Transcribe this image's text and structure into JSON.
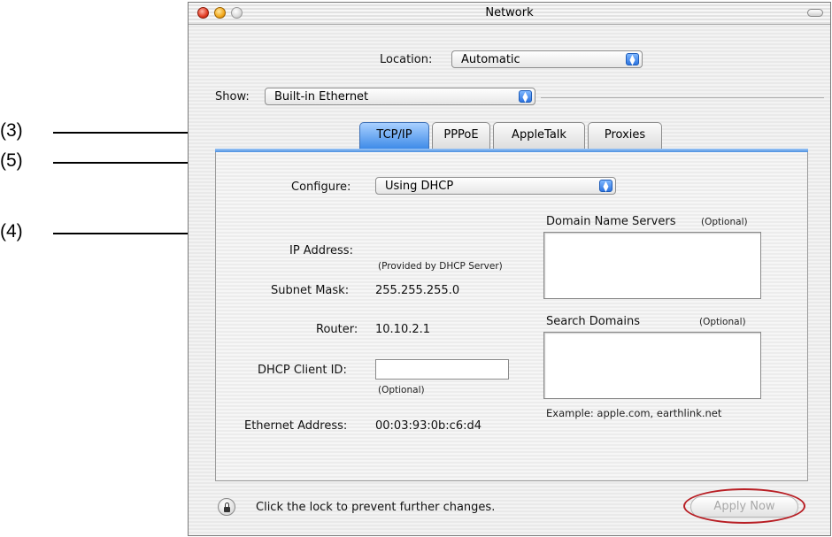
{
  "callouts": [
    {
      "label": "(3)"
    },
    {
      "label": "(5)"
    },
    {
      "label": "(4)"
    }
  ],
  "window": {
    "title": "Network",
    "location_label": "Location:",
    "location_value": "Automatic",
    "show_label": "Show:",
    "show_value": "Built-in Ethernet"
  },
  "tabs": [
    {
      "label": "TCP/IP",
      "active": true
    },
    {
      "label": "PPPoE",
      "active": false
    },
    {
      "label": "AppleTalk",
      "active": false
    },
    {
      "label": "Proxies",
      "active": false
    }
  ],
  "tcpip": {
    "configure_label": "Configure:",
    "configure_value": "Using DHCP",
    "ip_label": "IP Address:",
    "ip_note": "(Provided by DHCP Server)",
    "subnet_label": "Subnet Mask:",
    "subnet_value": "255.255.255.0",
    "router_label": "Router:",
    "router_value": "10.10.2.1",
    "dhcp_label": "DHCP Client ID:",
    "dhcp_value": "",
    "dhcp_note": "(Optional)",
    "ethernet_label": "Ethernet Address:",
    "ethernet_value": "00:03:93:0b:c6:d4",
    "dns_label": "Domain Name Servers",
    "dns_optional": "(Optional)",
    "search_label": "Search Domains",
    "search_optional": "(Optional)",
    "example_text": "Example: apple.com, earthlink.net"
  },
  "footer": {
    "lock_text": "Click the lock to prevent further changes.",
    "apply_label": "Apply Now"
  },
  "colors": {
    "highlight_ring": "#b81e24",
    "tab_active": "#3f8be8"
  }
}
